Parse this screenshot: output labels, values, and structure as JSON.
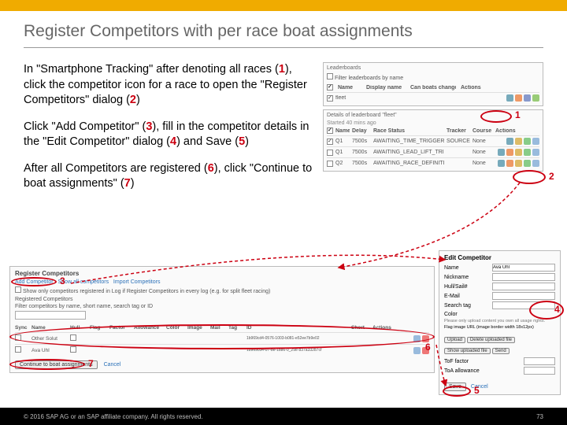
{
  "title": "Register Competitors with per race boat assignments",
  "para1_a": "In \"Smartphone Tracking\" after denoting all races (",
  "para1_b": "), click the competitor icon for a race to open the \"Register Competitors\" dialog (",
  "para1_c": ")",
  "para2_a": "Click \"Add Competitor\" (",
  "para2_b": "), fill in the competitor details in the \"Edit Competitor\" dialog (",
  "para2_c": ") and Save (",
  "para2_d": ")",
  "para3_a": "After all Competitors are registered (",
  "para3_b": "), click \"Continue to boat assignments\" (",
  "para3_c": ")",
  "n1": "1",
  "n2": "2",
  "n3": "3",
  "n4": "4",
  "n5": "5",
  "n6": "6",
  "n7": "7",
  "leaderboards": {
    "title": "Leaderboards",
    "filter": "Filter leaderboards by name",
    "hdr_name": "Name",
    "hdr_display": "Display name",
    "hdr_change": "Can boats change",
    "hdr_actions": "Actions",
    "row_name": "fleet"
  },
  "details": {
    "title": "Details of leaderboard \"fleet\"",
    "started": "Started 40 mins ago",
    "hdr_name": "Name",
    "hdr_delay": "Delay",
    "hdr_status": "Race Status",
    "hdr_tracker": "Tracker",
    "hdr_course": "Course",
    "hdr_actions": "Actions",
    "r1_name": "Q1",
    "r1_delay": "7500s",
    "r1_status": "AWAITING_TIME_TRIGGER",
    "r1_tracker": "SOURCE",
    "r1_course": "None",
    "r2_name": "Q1",
    "r2_delay": "7500s",
    "r2_status": "AWAITING_LEAD_LIFT_TRIGGER",
    "r2_course": "None",
    "r3_name": "Q2",
    "r3_delay": "7500s",
    "r3_status": "AWAITING_RACE_DEFINITION",
    "r3_course": "None"
  },
  "reg": {
    "title": "Register Competitors",
    "add": "Add Competitor",
    "show_all": "Show all competitors",
    "import": "Import Competitors",
    "cb": "Show only competitors registered in Log if Register Competitors in every log (e.g. for split fleet racing)",
    "section": "Registered Competitors",
    "filter": "Filter competitors by name, short name, search tag or ID",
    "h_sync": "Sync",
    "h_name": "Name",
    "h_hull": "Hull",
    "h_flag": "Flag",
    "h_factor": "Factor",
    "h_allow": "Allowance",
    "h_color": "Color",
    "h_image": "Image",
    "h_mail": "Mail",
    "h_tag": "Tag",
    "h_id": "ID",
    "h_short": "Short",
    "h_actions": "Actions",
    "row1": "Other Solut",
    "row1_id": "1b969cd4-0576-1003-b081-e52ee7b9e02",
    "row2": "Ava Uhl",
    "row2_id": "1b969cd4-07-8e-1886-0_29e-837a33287cf",
    "continue": "Continue to boat assignments",
    "cancel": "Cancel"
  },
  "edit": {
    "title": "Edit Competitor",
    "lbl_name": "Name",
    "val_name": "Ava Uhl",
    "lbl_nick": "Nickname",
    "lbl_hull": "Hull/Sail#",
    "lbl_email": "E-Mail",
    "lbl_tag": "Search tag",
    "color": "Color",
    "upload_hint": "Please only upload content you own all usage rights.",
    "flag": "Flag image URL (image border width 18x12px)",
    "upload": "Upload",
    "delete": "Delete uploaded file",
    "show": "Show uploaded file",
    "send": "Send",
    "tof": "ToF factor",
    "toa": "ToA allowance",
    "save": "Save",
    "cancel": "Cancel"
  },
  "footer_copy": "© 2016 SAP AG or an SAP affiliate company. All rights reserved.",
  "page": "73"
}
